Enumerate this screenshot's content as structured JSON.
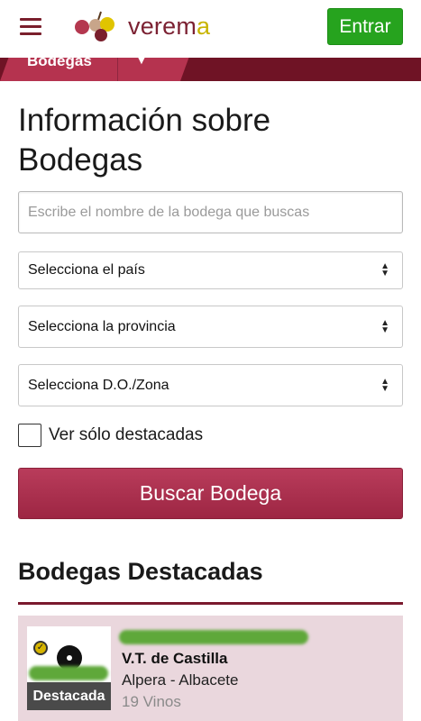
{
  "header": {
    "logo_text_dark": "verem",
    "logo_text_accent": "a",
    "login_label": "Entrar"
  },
  "nav": {
    "tab_label": "Bodegas",
    "caret": "▼"
  },
  "page": {
    "title": "Información sobre Bodegas"
  },
  "search": {
    "placeholder": "Escribe el nombre de la bodega que buscas"
  },
  "filters": {
    "country": "Selecciona el país",
    "province": "Selecciona la provincia",
    "zone": "Selecciona D.O./Zona"
  },
  "checkbox": {
    "label": "Ver sólo destacadas",
    "checked": false
  },
  "buttons": {
    "search_label": "Buscar Bodega"
  },
  "featured": {
    "section_title": "Bodegas Destacadas",
    "items": [
      {
        "badge": "Destacada",
        "region": "V.T. de Castilla",
        "location": "Alpera - Albacete",
        "wines": "19 Vinos"
      }
    ]
  },
  "colors": {
    "brand_wine": "#7c2233",
    "brand_gold": "#c8b400",
    "login_green": "#26a31e",
    "button_wine": "#b93c5b",
    "card_bg": "#ead7dd"
  }
}
